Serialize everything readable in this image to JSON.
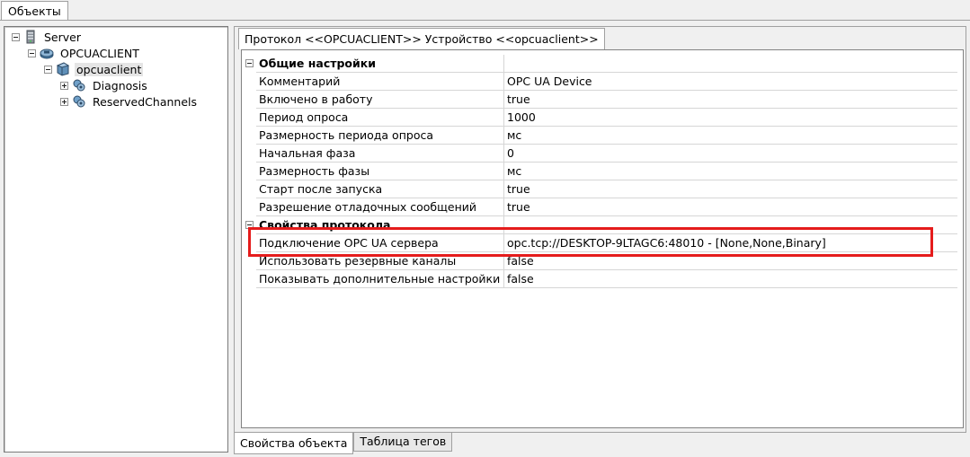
{
  "top_tab": {
    "label": "Объекты"
  },
  "tree": {
    "items": [
      {
        "label": "Server",
        "toggle": "minus",
        "icon": "server-icon"
      },
      {
        "label": "OPCUACLIENT",
        "toggle": "minus",
        "icon": "protocol-icon"
      },
      {
        "label": "opcuaclient",
        "toggle": "minus",
        "icon": "device-icon",
        "selected": true
      },
      {
        "label": "Diagnosis",
        "toggle": "plus",
        "icon": "channel-icon"
      },
      {
        "label": "ReservedChannels",
        "toggle": "plus",
        "icon": "channel-icon"
      }
    ]
  },
  "properties_tab": {
    "label": "Протокол <<OPCUACLIENT>> Устройство <<opcuaclient>>"
  },
  "grid": {
    "general": {
      "title": "Общие настройки",
      "rows": [
        {
          "name": "Комментарий",
          "value": "OPC UA Device"
        },
        {
          "name": "Включено в работу",
          "value": "true"
        },
        {
          "name": "Период опроса",
          "value": "1000"
        },
        {
          "name": "Размерность периода опроса",
          "value": "мс"
        },
        {
          "name": "Начальная фаза",
          "value": "0"
        },
        {
          "name": "Размерность фазы",
          "value": "мс"
        },
        {
          "name": "Старт после запуска",
          "value": "true"
        },
        {
          "name": "Разрешение отладочных сообщений",
          "value": "true"
        }
      ]
    },
    "protocol": {
      "title": "Свойства протокола",
      "rows": [
        {
          "name": "Подключение OPC UA сервера",
          "value": "opc.tcp://DESKTOP-9LTAGC6:48010 - [None,None,Binary]"
        },
        {
          "name": "Использовать резервные каналы",
          "value": "false"
        },
        {
          "name": "Показывать дополнительные настройки",
          "value": "false"
        }
      ]
    }
  },
  "bottom_tabs": [
    {
      "label": "Свойства объекта",
      "active": true
    },
    {
      "label": "Таблица тегов",
      "active": false
    }
  ],
  "colors": {
    "highlight": "#e51c1c",
    "selection": "#e5e5e5"
  }
}
